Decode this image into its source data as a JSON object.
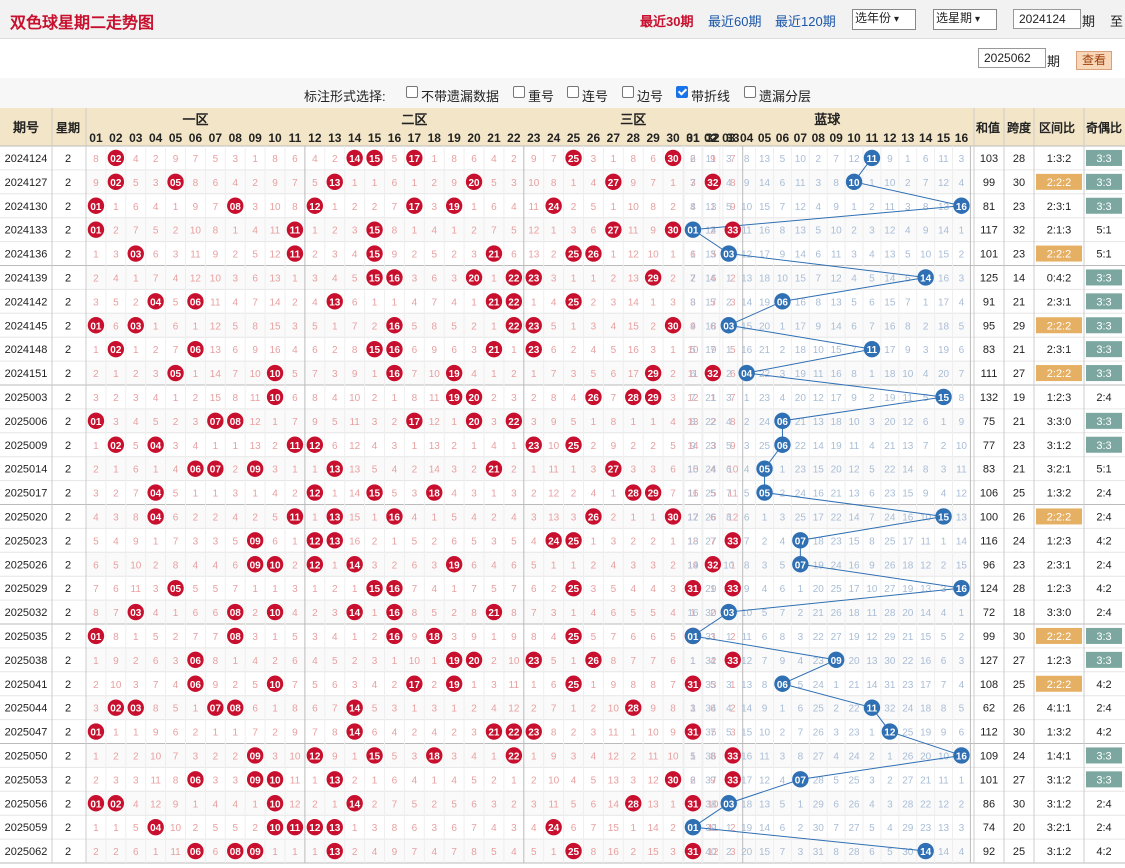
{
  "header": {
    "title": "双色球星期二走势图",
    "ranges": [
      {
        "label": "最近30期",
        "active": true
      },
      {
        "label": "最近60期",
        "active": false
      },
      {
        "label": "最近120期",
        "active": false
      }
    ],
    "year_select": "选年份",
    "week_select": "选星期",
    "from_issue": "2024124",
    "issue_unit": "期",
    "to_label": "至",
    "to_issue": "2025062",
    "to_unit": "期",
    "query_button": "查看"
  },
  "marks": {
    "label": "标注形式选择:",
    "options": [
      {
        "label": "不带遗漏数据",
        "checked": false
      },
      {
        "label": "重号",
        "checked": false
      },
      {
        "label": "连号",
        "checked": false
      },
      {
        "label": "边号",
        "checked": false
      },
      {
        "label": "带折线",
        "checked": true
      },
      {
        "label": "遗漏分层",
        "checked": false
      }
    ]
  },
  "table": {
    "col_issue": "期号",
    "col_weekday": "星期",
    "zones": [
      "一区",
      "二区",
      "三区"
    ],
    "blue_zone": "蓝球",
    "col_sum": "和值",
    "col_span": "跨度",
    "col_zone_ratio": "区间比",
    "col_odd_even": "奇偶比",
    "red_numbers": [
      "01",
      "02",
      "03",
      "04",
      "05",
      "06",
      "07",
      "08",
      "09",
      "10",
      "11",
      "12",
      "13",
      "14",
      "15",
      "16",
      "17",
      "18",
      "19",
      "20",
      "21",
      "22",
      "23",
      "24",
      "25",
      "26",
      "27",
      "28",
      "29",
      "30",
      "31",
      "32",
      "33"
    ],
    "blue_numbers": [
      "01",
      "02",
      "03",
      "04",
      "05",
      "06",
      "07",
      "08",
      "09",
      "10",
      "11",
      "12",
      "13",
      "14",
      "15",
      "16"
    ],
    "colors": {
      "red_ball": "#c8102e",
      "blue_ball": "#2f6fb3",
      "header_bg": "#f3e6c8",
      "zone_highlight": "#e6b064",
      "odd_even_highlight": "#7ba7a0"
    },
    "draws": [
      {
        "issue": "2024124",
        "weekday": "2",
        "reds": [
          2,
          14,
          15,
          17,
          25,
          30
        ],
        "blue": 11,
        "sum": "103",
        "span": "28",
        "zone_ratio": "1:3:2",
        "odd_even": "3:3"
      },
      {
        "issue": "2024127",
        "weekday": "2",
        "reds": [
          2,
          5,
          13,
          20,
          27,
          32
        ],
        "blue": 10,
        "sum": "99",
        "span": "30",
        "zone_ratio": "2:2:2",
        "odd_even": "3:3"
      },
      {
        "issue": "2024130",
        "weekday": "2",
        "reds": [
          1,
          8,
          12,
          17,
          19,
          24
        ],
        "blue": 16,
        "sum": "81",
        "span": "23",
        "zone_ratio": "2:3:1",
        "odd_even": "3:3"
      },
      {
        "issue": "2024133",
        "weekday": "2",
        "reds": [
          1,
          11,
          15,
          27,
          30,
          33
        ],
        "blue": 1,
        "sum": "117",
        "span": "32",
        "zone_ratio": "2:1:3",
        "odd_even": "5:1"
      },
      {
        "issue": "2024136",
        "weekday": "2",
        "reds": [
          3,
          11,
          15,
          21,
          25,
          26
        ],
        "blue": 3,
        "sum": "101",
        "span": "23",
        "zone_ratio": "2:2:2",
        "odd_even": "5:1"
      },
      {
        "issue": "2024139",
        "weekday": "2",
        "reds": [
          15,
          16,
          20,
          22,
          23,
          29
        ],
        "blue": 14,
        "sum": "125",
        "span": "14",
        "zone_ratio": "0:4:2",
        "odd_even": "3:3"
      },
      {
        "issue": "2024142",
        "weekday": "2",
        "reds": [
          4,
          6,
          13,
          21,
          22,
          25
        ],
        "blue": 6,
        "sum": "91",
        "span": "21",
        "zone_ratio": "2:3:1",
        "odd_even": "3:3"
      },
      {
        "issue": "2024145",
        "weekday": "2",
        "reds": [
          1,
          3,
          16,
          22,
          23,
          30
        ],
        "blue": 3,
        "sum": "95",
        "span": "29",
        "zone_ratio": "2:2:2",
        "odd_even": "3:3"
      },
      {
        "issue": "2024148",
        "weekday": "2",
        "reds": [
          2,
          6,
          15,
          16,
          21,
          23
        ],
        "blue": 11,
        "sum": "83",
        "span": "21",
        "zone_ratio": "2:3:1",
        "odd_even": "3:3"
      },
      {
        "issue": "2024151",
        "weekday": "2",
        "reds": [
          5,
          10,
          16,
          19,
          29,
          32
        ],
        "blue": 4,
        "sum": "111",
        "span": "27",
        "zone_ratio": "2:2:2",
        "odd_even": "3:3"
      },
      {
        "issue": "2025003",
        "weekday": "2",
        "reds": [
          10,
          19,
          20,
          26,
          28,
          29
        ],
        "blue": 15,
        "sum": "132",
        "span": "19",
        "zone_ratio": "1:2:3",
        "odd_even": "2:4"
      },
      {
        "issue": "2025006",
        "weekday": "2",
        "reds": [
          1,
          7,
          8,
          17,
          20,
          22
        ],
        "blue": 6,
        "sum": "75",
        "span": "21",
        "zone_ratio": "3:3:0",
        "odd_even": "3:3"
      },
      {
        "issue": "2025009",
        "weekday": "2",
        "reds": [
          2,
          4,
          11,
          12,
          23,
          25
        ],
        "blue": 6,
        "sum": "77",
        "span": "23",
        "zone_ratio": "3:1:2",
        "odd_even": "3:3"
      },
      {
        "issue": "2025014",
        "weekday": "2",
        "reds": [
          6,
          7,
          9,
          13,
          21,
          27
        ],
        "blue": 5,
        "sum": "83",
        "span": "21",
        "zone_ratio": "3:2:1",
        "odd_even": "5:1"
      },
      {
        "issue": "2025017",
        "weekday": "2",
        "reds": [
          4,
          12,
          15,
          18,
          28,
          29
        ],
        "blue": 5,
        "sum": "106",
        "span": "25",
        "zone_ratio": "1:3:2",
        "odd_even": "2:4"
      },
      {
        "issue": "2025020",
        "weekday": "2",
        "reds": [
          4,
          11,
          13,
          16,
          26,
          30
        ],
        "blue": 15,
        "sum": "100",
        "span": "26",
        "zone_ratio": "2:2:2",
        "odd_even": "2:4"
      },
      {
        "issue": "2025023",
        "weekday": "2",
        "reds": [
          9,
          12,
          13,
          24,
          25,
          33
        ],
        "blue": 7,
        "sum": "116",
        "span": "24",
        "zone_ratio": "1:2:3",
        "odd_even": "4:2"
      },
      {
        "issue": "2025026",
        "weekday": "2",
        "reds": [
          9,
          10,
          12,
          14,
          19,
          32
        ],
        "blue": 7,
        "sum": "96",
        "span": "23",
        "zone_ratio": "2:3:1",
        "odd_even": "2:4"
      },
      {
        "issue": "2025029",
        "weekday": "2",
        "reds": [
          5,
          15,
          16,
          25,
          31,
          33
        ],
        "blue": 16,
        "sum": "124",
        "span": "28",
        "zone_ratio": "1:2:3",
        "odd_even": "4:2"
      },
      {
        "issue": "2025032",
        "weekday": "2",
        "reds": [
          3,
          8,
          10,
          14,
          16,
          21
        ],
        "blue": 3,
        "sum": "72",
        "span": "18",
        "zone_ratio": "3:3:0",
        "odd_even": "2:4"
      },
      {
        "issue": "2025035",
        "weekday": "2",
        "reds": [
          1,
          8,
          16,
          18,
          25,
          31
        ],
        "blue": 1,
        "sum": "99",
        "span": "30",
        "zone_ratio": "2:2:2",
        "odd_even": "3:3"
      },
      {
        "issue": "2025038",
        "weekday": "2",
        "reds": [
          6,
          19,
          20,
          23,
          26,
          33
        ],
        "blue": 9,
        "sum": "127",
        "span": "27",
        "zone_ratio": "1:2:3",
        "odd_even": "3:3"
      },
      {
        "issue": "2025041",
        "weekday": "2",
        "reds": [
          6,
          10,
          17,
          19,
          25,
          31
        ],
        "blue": 6,
        "sum": "108",
        "span": "25",
        "zone_ratio": "2:2:2",
        "odd_even": "4:2"
      },
      {
        "issue": "2025044",
        "weekday": "2",
        "reds": [
          2,
          3,
          7,
          8,
          14,
          28
        ],
        "blue": 11,
        "sum": "62",
        "span": "26",
        "zone_ratio": "4:1:1",
        "odd_even": "2:4"
      },
      {
        "issue": "2025047",
        "weekday": "2",
        "reds": [
          1,
          14,
          21,
          22,
          23,
          31
        ],
        "blue": 12,
        "sum": "112",
        "span": "30",
        "zone_ratio": "1:3:2",
        "odd_even": "4:2"
      },
      {
        "issue": "2025050",
        "weekday": "2",
        "reds": [
          9,
          12,
          15,
          18,
          22,
          33
        ],
        "blue": 16,
        "sum": "109",
        "span": "24",
        "zone_ratio": "1:4:1",
        "odd_even": "3:3"
      },
      {
        "issue": "2025053",
        "weekday": "2",
        "reds": [
          6,
          9,
          10,
          13,
          30,
          33
        ],
        "blue": 7,
        "sum": "101",
        "span": "27",
        "zone_ratio": "3:1:2",
        "odd_even": "3:3"
      },
      {
        "issue": "2025056",
        "weekday": "2",
        "reds": [
          1,
          2,
          10,
          14,
          28,
          31
        ],
        "blue": 3,
        "sum": "86",
        "span": "30",
        "zone_ratio": "3:1:2",
        "odd_even": "2:4"
      },
      {
        "issue": "2025059",
        "weekday": "2",
        "reds": [
          4,
          10,
          11,
          12,
          13,
          24
        ],
        "blue": 1,
        "sum": "74",
        "span": "20",
        "zone_ratio": "3:2:1",
        "odd_even": "2:4"
      },
      {
        "issue": "2025062",
        "weekday": "2",
        "reds": [
          6,
          8,
          9,
          13,
          25,
          31
        ],
        "blue": 14,
        "sum": "92",
        "span": "25",
        "zone_ratio": "3:1:2",
        "odd_even": "4:2"
      }
    ]
  }
}
